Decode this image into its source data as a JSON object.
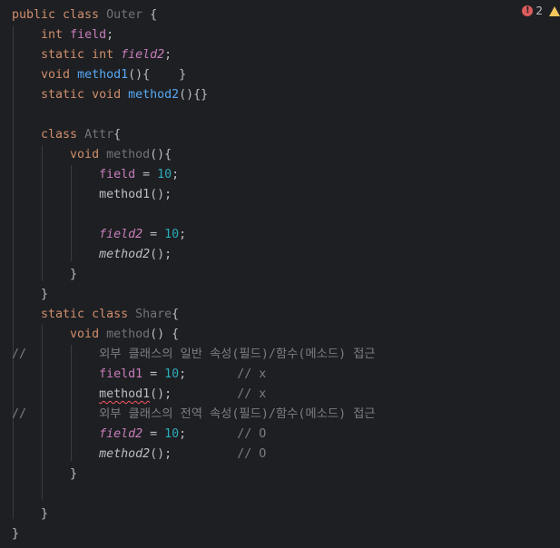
{
  "inspection": {
    "error_count": "2",
    "error_icon_glyph": "!",
    "error_color": "#db5c5c",
    "warning_color": "#f2c55c"
  },
  "code_lines": [
    [
      {
        "t": "public class ",
        "c": "kw"
      },
      {
        "t": "Outer",
        "c": "cls"
      },
      {
        "t": " {",
        "c": "pl"
      }
    ],
    [
      {
        "t": "    ",
        "c": "pl"
      },
      {
        "t": "int ",
        "c": "kw"
      },
      {
        "t": "field",
        "c": "fld"
      },
      {
        "t": ";",
        "c": "pl"
      }
    ],
    [
      {
        "t": "    ",
        "c": "pl"
      },
      {
        "t": "static int ",
        "c": "kw"
      },
      {
        "t": "field2",
        "c": "fld-i"
      },
      {
        "t": ";",
        "c": "pl"
      }
    ],
    [
      {
        "t": "    ",
        "c": "pl"
      },
      {
        "t": "void ",
        "c": "kw"
      },
      {
        "t": "method1",
        "c": "fn"
      },
      {
        "t": "(){    }",
        "c": "pl"
      }
    ],
    [
      {
        "t": "    ",
        "c": "pl"
      },
      {
        "t": "static void ",
        "c": "kw"
      },
      {
        "t": "method2",
        "c": "fn"
      },
      {
        "t": "(){}",
        "c": "pl"
      }
    ],
    [],
    [
      {
        "t": "    ",
        "c": "pl"
      },
      {
        "t": "class ",
        "c": "kw"
      },
      {
        "t": "Attr",
        "c": "cls"
      },
      {
        "t": "{",
        "c": "pl"
      }
    ],
    [
      {
        "t": "        ",
        "c": "pl"
      },
      {
        "t": "void ",
        "c": "kw"
      },
      {
        "t": "method",
        "c": "cls"
      },
      {
        "t": "(){",
        "c": "pl"
      }
    ],
    [
      {
        "t": "            ",
        "c": "pl"
      },
      {
        "t": "field",
        "c": "fld"
      },
      {
        "t": " = ",
        "c": "pl"
      },
      {
        "t": "10",
        "c": "num"
      },
      {
        "t": ";",
        "c": "pl"
      }
    ],
    [
      {
        "t": "            method1();",
        "c": "pl"
      }
    ],
    [],
    [
      {
        "t": "            ",
        "c": "pl"
      },
      {
        "t": "field2",
        "c": "fld-i"
      },
      {
        "t": " = ",
        "c": "pl"
      },
      {
        "t": "10",
        "c": "num"
      },
      {
        "t": ";",
        "c": "pl"
      }
    ],
    [
      {
        "t": "            ",
        "c": "pl"
      },
      {
        "t": "method2",
        "c": "it"
      },
      {
        "t": "();",
        "c": "pl"
      }
    ],
    [
      {
        "t": "        }",
        "c": "pl"
      }
    ],
    [
      {
        "t": "    }",
        "c": "pl"
      }
    ],
    [
      {
        "t": "    ",
        "c": "pl"
      },
      {
        "t": "static class ",
        "c": "kw"
      },
      {
        "t": "Share",
        "c": "cls"
      },
      {
        "t": "{",
        "c": "pl"
      }
    ],
    [
      {
        "t": "        ",
        "c": "pl"
      },
      {
        "t": "void ",
        "c": "kw"
      },
      {
        "t": "method",
        "c": "cls"
      },
      {
        "t": "() {",
        "c": "pl"
      }
    ],
    [
      {
        "t": "//          외부 클래스의 일반 속성(필드)/함수(메소드) 접근",
        "c": "cm"
      }
    ],
    [
      {
        "t": "            ",
        "c": "pl"
      },
      {
        "t": "field1",
        "c": "fld"
      },
      {
        "t": " = ",
        "c": "pl"
      },
      {
        "t": "10",
        "c": "num"
      },
      {
        "t": ";       ",
        "c": "pl"
      },
      {
        "t": "// x",
        "c": "cm"
      }
    ],
    [
      {
        "t": "            ",
        "c": "pl"
      },
      {
        "t": "method1",
        "c": "err"
      },
      {
        "t": "();         ",
        "c": "pl"
      },
      {
        "t": "// x",
        "c": "cm"
      }
    ],
    [
      {
        "t": "//          외부 클래스의 전역 속성(필드)/함수(메소드) 접근",
        "c": "cm"
      }
    ],
    [
      {
        "t": "            ",
        "c": "pl"
      },
      {
        "t": "field2",
        "c": "fld-i"
      },
      {
        "t": " = ",
        "c": "pl"
      },
      {
        "t": "10",
        "c": "num"
      },
      {
        "t": ";       ",
        "c": "pl"
      },
      {
        "t": "// O",
        "c": "cm"
      }
    ],
    [
      {
        "t": "            ",
        "c": "pl"
      },
      {
        "t": "method2",
        "c": "it"
      },
      {
        "t": "();         ",
        "c": "pl"
      },
      {
        "t": "// O",
        "c": "cm"
      }
    ],
    [
      {
        "t": "        }",
        "c": "pl"
      }
    ],
    [],
    [
      {
        "t": "    }",
        "c": "pl"
      }
    ],
    [
      {
        "t": "}",
        "c": "pl"
      }
    ]
  ]
}
